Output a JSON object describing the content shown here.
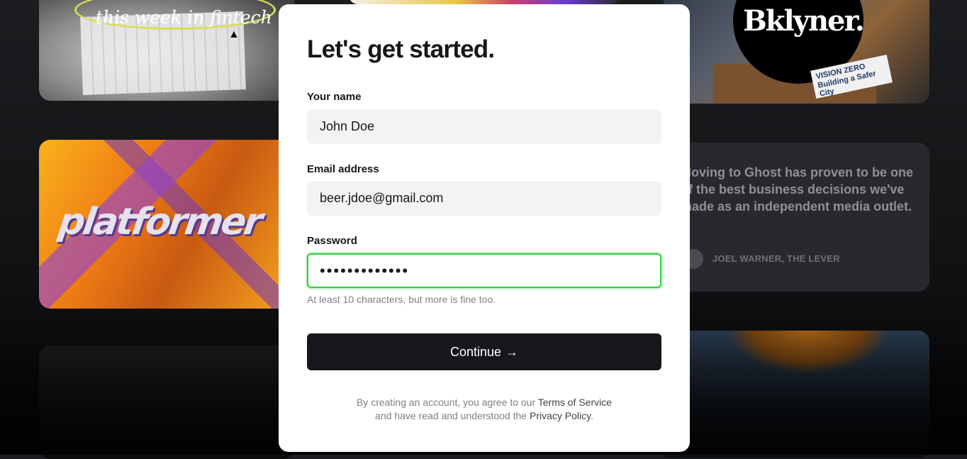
{
  "background": {
    "fintech_card": {
      "text": "this week in fintech"
    },
    "bklyner_card": {
      "logo": "Bklyner.",
      "sign_line1": "VISION ZERO",
      "sign_line2": "Building a Safer City"
    },
    "platformer_card": {
      "text": "platformer"
    },
    "testimonial": {
      "quote": "Moving to Ghost has proven to be one of the best business decisions we've made as an independent media outlet.",
      "author": "JOEL WARNER, THE LEVER"
    }
  },
  "modal": {
    "title": "Let's get started.",
    "name": {
      "label": "Your name",
      "value": "John Doe"
    },
    "email": {
      "label": "Email address",
      "value": "beer.jdoe@gmail.com"
    },
    "password": {
      "label": "Password",
      "value": "•••••••••••••",
      "hint": "At least 10 characters, but more is fine too."
    },
    "continue_label": "Continue",
    "continue_arrow": "→",
    "terms": {
      "pre": "By creating an account, you agree to our ",
      "terms_link": "Terms of Service",
      "mid": "and have read and understood the ",
      "privacy_link": "Privacy Policy",
      "end": "."
    }
  },
  "colors": {
    "accent_focus": "#30cf43",
    "button": "#15171a"
  }
}
